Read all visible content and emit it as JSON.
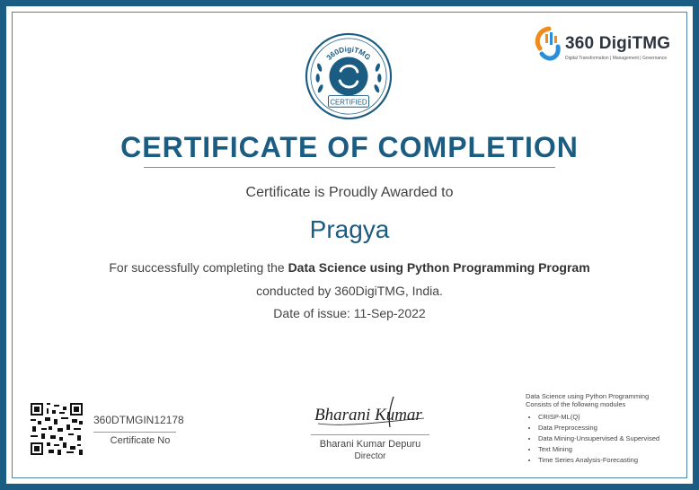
{
  "seal": {
    "top_text": "360DigiTMG",
    "bottom_text": "CERTIFIED"
  },
  "logo": {
    "name": "360 DigiTMG",
    "tagline": "Digital Transformation | Management | Governance"
  },
  "title": "CERTIFICATE OF COMPLETION",
  "awarded_text": "Certificate is Proudly Awarded to",
  "recipient": "Pragya",
  "completion": {
    "prefix": "For successfully completing the ",
    "program": "Data Science using Python Programming Program",
    "conducted": "conducted by 360DigiTMG, India.",
    "date": "Date of issue: 11-Sep-2022"
  },
  "certificate": {
    "number": "360DTMGIN12178",
    "label": "Certificate No"
  },
  "signatory": {
    "signature_text": "Bharani Kumar",
    "name": "Bharani Kumar Depuru",
    "role": "Director"
  },
  "modules": {
    "heading_line1": "Data Science using Python Programming",
    "heading_line2": "Consists of the following modules",
    "items": [
      "CRISP-ML(Q)",
      "Data Preprocessing",
      "Data Mining-Unsupervised & Supervised",
      "Text Mining",
      "Time Series Analysis-Forecasting"
    ]
  },
  "colors": {
    "brand_blue": "#1b5c82",
    "logo_orange": "#f08a1c",
    "logo_blue": "#2a8fd6"
  }
}
